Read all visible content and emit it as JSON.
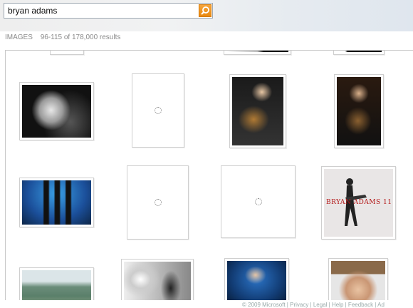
{
  "search": {
    "query": "bryan adams"
  },
  "results": {
    "section": "IMAGES",
    "range": "96-115 of 178,000 results"
  },
  "album_art": {
    "text": "BRYAN ADAMS 11"
  },
  "footer": {
    "text": "© 2009 Microsoft  |  Privacy  |  Legal  |  Help  |  Feedback  |  Ad"
  },
  "thumbnails": [
    {
      "name": "image-result-bw-portrait",
      "state": "loaded"
    },
    {
      "name": "image-result-loading-1",
      "state": "loading"
    },
    {
      "name": "image-result-concert-guitar-1",
      "state": "loaded"
    },
    {
      "name": "image-result-concert-guitar-2",
      "state": "loaded"
    },
    {
      "name": "image-result-band-stage",
      "state": "loaded"
    },
    {
      "name": "image-result-loading-2",
      "state": "loading"
    },
    {
      "name": "image-result-loading-3",
      "state": "loading"
    },
    {
      "name": "image-result-album-11",
      "state": "loaded"
    },
    {
      "name": "image-result-festival-crowd",
      "state": "loaded"
    },
    {
      "name": "image-result-bw-live",
      "state": "loaded"
    },
    {
      "name": "image-result-mic-stage",
      "state": "loaded"
    },
    {
      "name": "image-result-face-closeup",
      "state": "loaded"
    }
  ]
}
